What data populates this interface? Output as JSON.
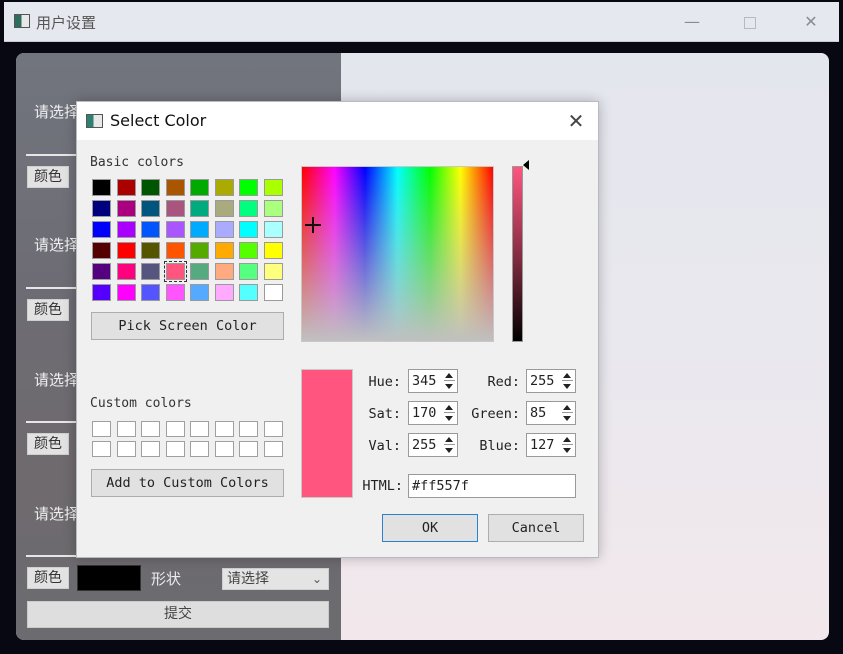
{
  "window": {
    "title": "用户设置",
    "controls": {
      "minimize": "—",
      "close": "✕"
    }
  },
  "form": {
    "rows": [
      {
        "prompt": "请选择",
        "color_button": "颜色"
      },
      {
        "prompt": "请选择",
        "color_button": "颜色"
      },
      {
        "prompt": "请选择",
        "color_button": "颜色"
      },
      {
        "prompt": "请选择",
        "color_button": "颜色"
      }
    ],
    "bottom": {
      "color_button": "颜色",
      "current_color": "#000000",
      "shape_label": "形状",
      "shape_select_value": "请选择",
      "submit_label": "提交"
    }
  },
  "dialog": {
    "title": "Select Color",
    "basic_colors_label": "Basic colors",
    "basic_colors": [
      "#000000",
      "#aa0000",
      "#005500",
      "#aa5500",
      "#00aa00",
      "#aaaa00",
      "#00ff00",
      "#aaff00",
      "#00007f",
      "#aa007f",
      "#00557f",
      "#aa557f",
      "#00aa7f",
      "#aaaa7f",
      "#00ff7f",
      "#aaff7f",
      "#0000ff",
      "#aa00ff",
      "#0055ff",
      "#aa55ff",
      "#00aaff",
      "#aaaaff",
      "#00ffff",
      "#aaffff",
      "#550000",
      "#ff0000",
      "#555500",
      "#ff5500",
      "#55aa00",
      "#ffaa00",
      "#55ff00",
      "#ffff00",
      "#55007f",
      "#ff007f",
      "#55557f",
      "#ff557f",
      "#55aa7f",
      "#ffaa7f",
      "#55ff7f",
      "#ffff7f",
      "#5500ff",
      "#ff00ff",
      "#5555ff",
      "#ff55ff",
      "#55aaff",
      "#ffaaff",
      "#55ffff",
      "#ffffff"
    ],
    "selected_basic_index": 35,
    "pick_screen_label": "Pick Screen Color",
    "custom_colors_label": "Custom colors",
    "custom_colors_count": 16,
    "add_custom_label": "Add to Custom Colors",
    "current_color": "#ff557f",
    "fields": {
      "hue_label": "Hue:",
      "hue": "345",
      "sat_label": "Sat:",
      "sat": "170",
      "val_label": "Val:",
      "val": "255",
      "red_label": "Red:",
      "red": "255",
      "green_label": "Green:",
      "green": "85",
      "blue_label": "Blue:",
      "blue": "127",
      "html_label": "HTML:",
      "html": "#ff557f"
    },
    "ok_label": "OK",
    "cancel_label": "Cancel",
    "close_glyph": "✕"
  }
}
